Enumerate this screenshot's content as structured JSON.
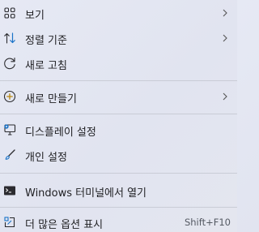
{
  "menu": {
    "items": [
      {
        "label": "보기",
        "icon": "view-icon",
        "submenu": true
      },
      {
        "label": "정렬 기준",
        "icon": "sort-icon",
        "submenu": true
      },
      {
        "label": "새로 고침",
        "icon": "refresh-icon",
        "submenu": false
      },
      {
        "label": "새로 만들기",
        "icon": "new-plus-icon",
        "submenu": true
      },
      {
        "label": "디스플레이 설정",
        "icon": "display-icon",
        "submenu": false
      },
      {
        "label": "개인 설정",
        "icon": "personalize-brush-icon",
        "submenu": false
      },
      {
        "label": "Windows 터미널에서 열기",
        "icon": "terminal-icon",
        "submenu": false
      },
      {
        "label": "더 많은 옵션 표시",
        "icon": "more-options-icon",
        "shortcut": "Shift+F10",
        "submenu": false
      }
    ]
  },
  "colors": {
    "background": "#e3e6f1",
    "text": "#1f1f22",
    "accent": "#1a73c8",
    "separator": "#c9ccd6"
  }
}
